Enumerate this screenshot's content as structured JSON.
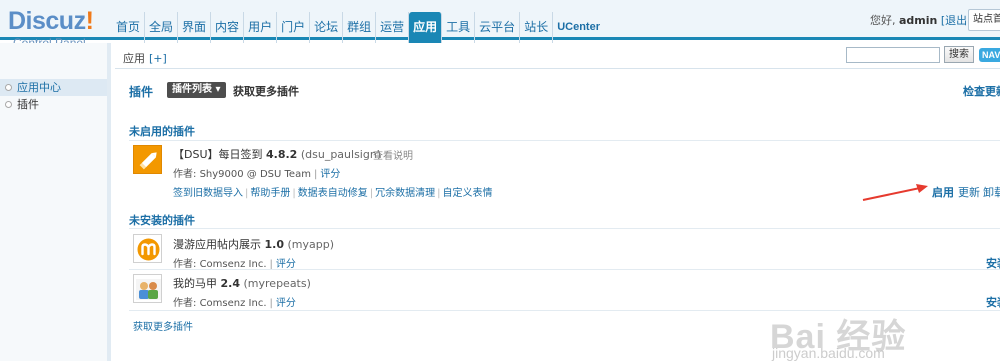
{
  "brand": {
    "name": "Discuz",
    "bang": "!",
    "subtitle": "Control Panel"
  },
  "nav": [
    {
      "label": "首页"
    },
    {
      "label": "全局"
    },
    {
      "label": "界面"
    },
    {
      "label": "内容"
    },
    {
      "label": "用户"
    },
    {
      "label": "门户"
    },
    {
      "label": "论坛"
    },
    {
      "label": "群组"
    },
    {
      "label": "运营"
    },
    {
      "label": "应用",
      "active": true
    },
    {
      "label": "工具"
    },
    {
      "label": "云平台"
    },
    {
      "label": "站长"
    },
    {
      "label": "UCenter"
    }
  ],
  "user": {
    "greeting": "您好, ",
    "name": "admin",
    "logout": "[退出]",
    "site_home": "站点首页"
  },
  "breadcrumb": {
    "text": "应用",
    "plus": "[+]"
  },
  "search": {
    "button": "搜索",
    "nav_badge": "NAV"
  },
  "sidebar": {
    "items": [
      {
        "label": "应用中心",
        "active": true
      },
      {
        "label": "插件"
      }
    ]
  },
  "main": {
    "title": "插件",
    "tab_list": "插件列表 ▾",
    "tab_more": "获取更多插件",
    "check_update": "检查更新",
    "disabled_section": "未启用的插件",
    "uninstalled_section": "未安装的插件",
    "more_plugins": "获取更多插件",
    "disabled_plugins": [
      {
        "name": "【DSU】每日签到",
        "version": "4.8.2",
        "id": "(dsu_paulsign)",
        "read_more": "查看说明",
        "author_label": "作者: ",
        "author": "Shy9000 @ DSU Team",
        "rate": "评分",
        "links": [
          "签到旧数据导入",
          "帮助手册",
          "数据表自动修复",
          "冗余数据清理",
          "自定义表情"
        ],
        "actions": [
          "启用",
          "更新",
          "卸载"
        ]
      }
    ],
    "uninstalled_plugins": [
      {
        "name": "漫游应用帖内展示",
        "version": "1.0",
        "id": "(myapp)",
        "author_label": "作者: ",
        "author": "Comsenz Inc.",
        "rate": "评分",
        "action": "安装"
      },
      {
        "name": "我的马甲",
        "version": "2.4",
        "id": "(myrepeats)",
        "author_label": "作者: ",
        "author": "Comsenz Inc.",
        "rate": "评分",
        "action": "安装"
      }
    ]
  },
  "colors": {
    "accent": "#1a87b5",
    "link": "#1c6fa6",
    "arrow": "#e63a2e",
    "icon_orange": "#f39800"
  },
  "watermark": {
    "big": "Bai 经验",
    "url": "jingyan.baidu.com"
  }
}
